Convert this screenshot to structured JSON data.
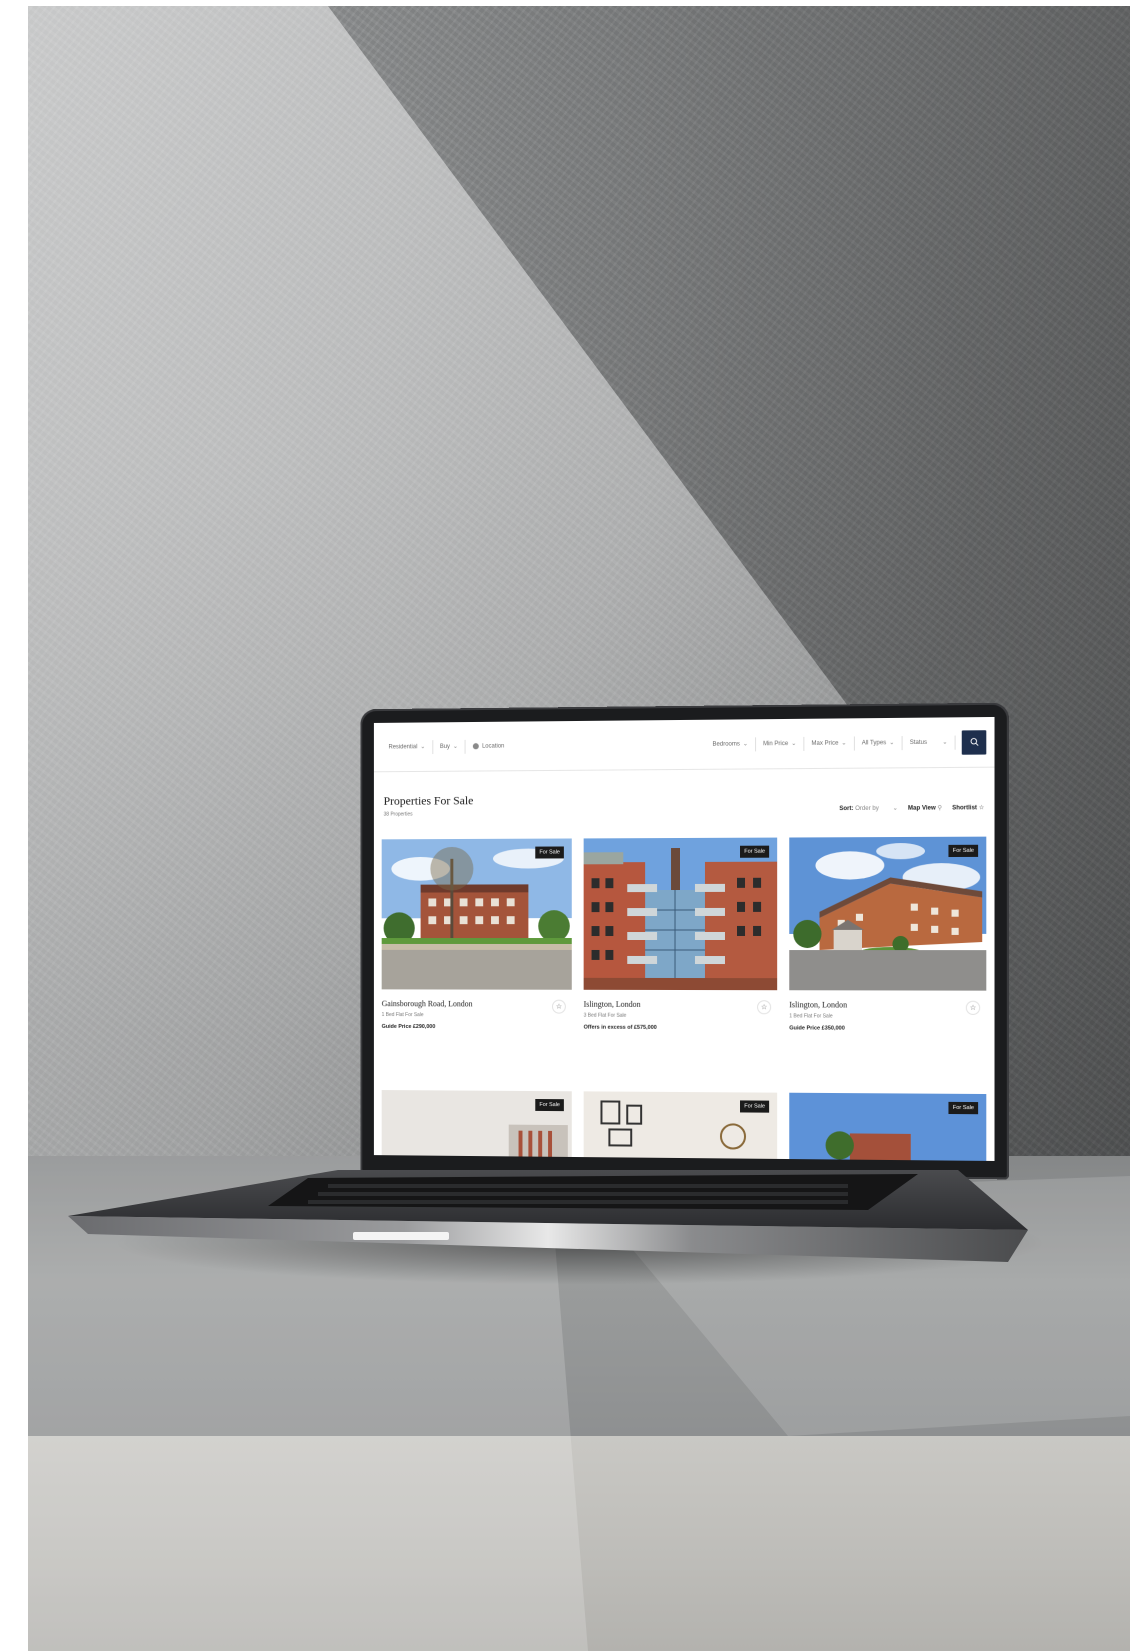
{
  "filters": {
    "residential": "Residential",
    "buy": "Buy",
    "location_placeholder": "Location",
    "bedrooms": "Bedrooms",
    "min_price": "Min Price",
    "max_price": "Max Price",
    "all_types": "All Types",
    "status": "Status"
  },
  "page": {
    "title": "Properties For Sale",
    "count": "38 Properties",
    "sort_label": "Sort:",
    "sort_value": "Order by",
    "map_view": "Map View",
    "shortlist": "Shortlist"
  },
  "listings": [
    {
      "badge": "For Sale",
      "title": "Gainsborough Road, London",
      "type": "1 Bed Flat For Sale",
      "price": "Guide Price £290,000"
    },
    {
      "badge": "For Sale",
      "title": "Islington, London",
      "type": "3 Bed Flat For Sale",
      "price": "Offers in excess of £575,000"
    },
    {
      "badge": "For Sale",
      "title": "Islington, London",
      "type": "1 Bed Flat For Sale",
      "price": "Guide Price £350,000"
    }
  ],
  "listings_row2": [
    {
      "badge": "For Sale"
    },
    {
      "badge": "For Sale"
    },
    {
      "badge": "For Sale"
    }
  ],
  "colors": {
    "accent": "#1e2f4d",
    "badge": "#1b1b1b"
  },
  "icons": {
    "search": "search-icon",
    "pin": "location-pin-icon",
    "star": "star-icon",
    "chevron": "chevron-down-icon"
  }
}
